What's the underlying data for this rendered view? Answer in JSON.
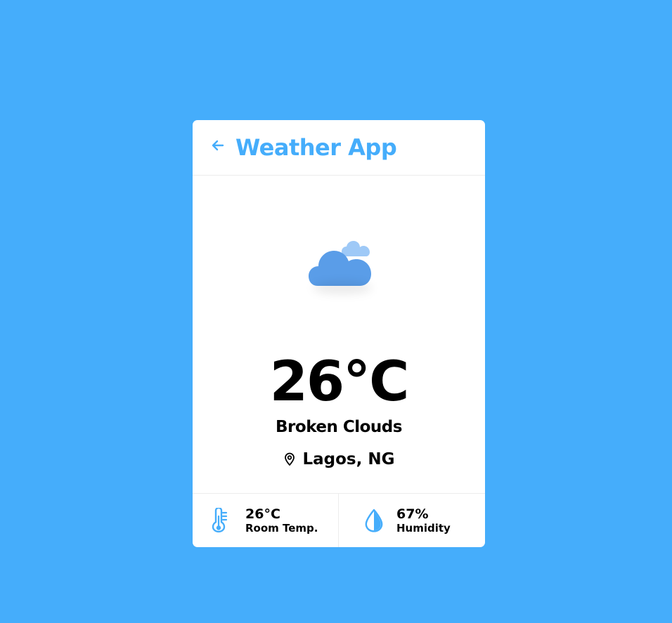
{
  "app": {
    "title": "Weather App",
    "back_icon": "arrow-left-icon",
    "accent_color": "#45adfb"
  },
  "weather": {
    "icon": "broken-clouds-icon",
    "temperature": "26°C",
    "description": "Broken Clouds",
    "location": "Lagos, NG",
    "location_icon": "map-pin-icon"
  },
  "stats": {
    "room_temp": {
      "value": "26°C",
      "label": "Room Temp.",
      "icon": "thermometer-icon"
    },
    "humidity": {
      "value": "67%",
      "label": "Humidity",
      "icon": "water-drop-icon"
    }
  }
}
